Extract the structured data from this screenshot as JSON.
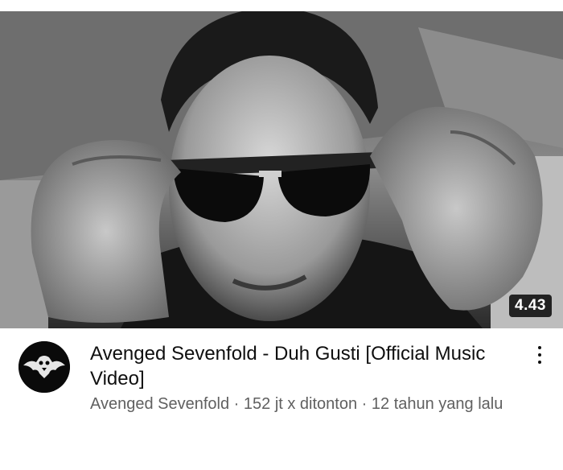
{
  "video": {
    "duration": "4.43",
    "title": "Avenged Sevenfold - Duh Gusti [Official Music Video]",
    "channel": "Avenged Sevenfold",
    "views": "152 jt x ditonton",
    "age": "12 tahun yang lalu",
    "separator": " · "
  },
  "icons": {
    "avatar": "deathbat-logo",
    "menu": "more-vert-icon"
  },
  "colors": {
    "title": "#0f0f0f",
    "subtitle": "#606060",
    "duration_bg": "#000000"
  }
}
